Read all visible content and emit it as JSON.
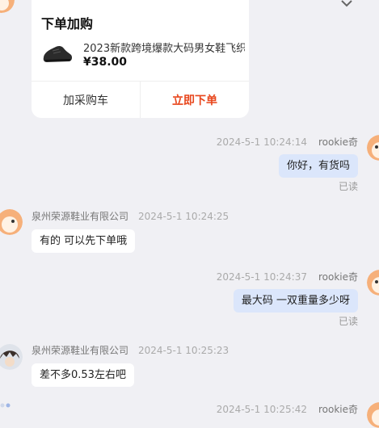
{
  "order_card": {
    "title": "下单加购",
    "product_name": "2023新款跨境爆款大码男女鞋飞织",
    "price": "¥38.00",
    "add_to_cart_label": "加采购车",
    "order_now_label": "立即下单"
  },
  "messages": [
    {
      "side": "right",
      "time": "2024-5-1 10:24:14",
      "sender": "rookie奇",
      "text": "你好，有货吗",
      "status": "已读"
    },
    {
      "side": "left",
      "sender": "泉州荣源鞋业有限公司",
      "time": "2024-5-1 10:24:25",
      "text": "有的 可以先下单哦"
    },
    {
      "side": "right",
      "time": "2024-5-1 10:24:37",
      "sender": "rookie奇",
      "text": "最大码 一双重量多少呀",
      "status": "已读"
    },
    {
      "side": "left",
      "sender": "泉州荣源鞋业有限公司",
      "time": "2024-5-1 10:25:23",
      "text": "差不多0.53左右吧"
    },
    {
      "side": "right",
      "time": "2024-5-1 10:25:42",
      "sender": "rookie奇"
    }
  ],
  "colors": {
    "background": "#f0f0f4",
    "accent": "#e8461c",
    "bubble_self": "#dbe6fb",
    "bubble_other": "#ffffff"
  },
  "icons": [
    "shoe-thumbnail",
    "user-avatar-cartoon",
    "seller-avatar-cartoon"
  ]
}
